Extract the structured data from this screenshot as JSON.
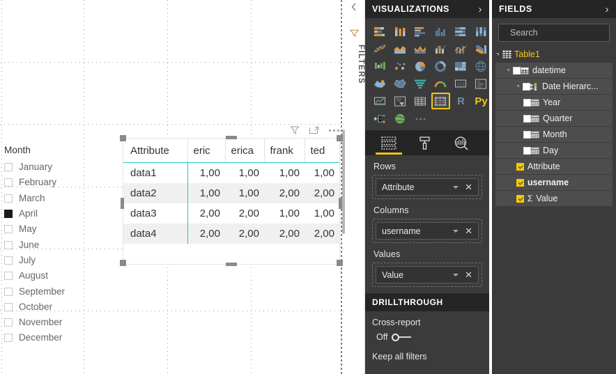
{
  "canvas": {
    "slicer": {
      "title": "Month",
      "items": [
        {
          "label": "January",
          "checked": false
        },
        {
          "label": "February",
          "checked": false
        },
        {
          "label": "March",
          "checked": false
        },
        {
          "label": "April",
          "checked": true
        },
        {
          "label": "May",
          "checked": false
        },
        {
          "label": "June",
          "checked": false
        },
        {
          "label": "July",
          "checked": false
        },
        {
          "label": "August",
          "checked": false
        },
        {
          "label": "September",
          "checked": false
        },
        {
          "label": "October",
          "checked": false
        },
        {
          "label": "November",
          "checked": false
        },
        {
          "label": "December",
          "checked": false
        }
      ]
    },
    "visual_header": {
      "filter_icon": "filter-funnel-icon",
      "focus_icon": "focus-mode-icon",
      "more_icon": "more-options-icon"
    },
    "matrix": {
      "columns": [
        "Attribute",
        "eric",
        "erica",
        "frank",
        "ted"
      ],
      "rows": [
        {
          "attribute": "data1",
          "values": [
            "1,00",
            "1,00",
            "1,00",
            "1,00"
          ]
        },
        {
          "attribute": "data2",
          "values": [
            "1,00",
            "1,00",
            "2,00",
            "2,00"
          ]
        },
        {
          "attribute": "data3",
          "values": [
            "2,00",
            "2,00",
            "1,00",
            "1,00"
          ]
        },
        {
          "attribute": "data4",
          "values": [
            "2,00",
            "2,00",
            "2,00",
            "2,00"
          ]
        }
      ],
      "accent_color": "#20c5c9",
      "alt_row_color": "#f0f0f0"
    }
  },
  "filters_rail": {
    "label": "FILTERS",
    "collapse_icon": "chevron-left-icon",
    "funnel_icon": "filter-funnel-icon"
  },
  "visualizations": {
    "title": "VISUALIZATIONS",
    "collapse_chevron": "›",
    "selected_visual": "matrix",
    "icons": [
      "stacked-bar-chart-icon",
      "stacked-column-chart-icon",
      "clustered-bar-chart-icon",
      "clustered-column-chart-icon",
      "100-stacked-bar-chart-icon",
      "100-stacked-column-chart-icon",
      "line-chart-icon",
      "area-chart-icon",
      "stacked-area-chart-icon",
      "line-stacked-column-chart-icon",
      "line-clustered-column-chart-icon",
      "ribbon-chart-icon",
      "waterfall-chart-icon",
      "scatter-chart-icon",
      "pie-chart-icon",
      "donut-chart-icon",
      "treemap-icon",
      "map-icon",
      "filled-map-icon",
      "shape-map-icon",
      "funnel-chart-icon",
      "gauge-chart-icon",
      "card-icon",
      "multi-row-card-icon",
      "kpi-icon",
      "slicer-icon",
      "table-icon",
      "matrix-icon",
      "r-script-visual-icon",
      "python-visual-icon",
      "decomposition-tree-icon",
      "arcgis-map-icon",
      "more-visuals-icon"
    ],
    "tabs": [
      {
        "name": "fields-tab",
        "icon": "fields-pane-icon",
        "active": true
      },
      {
        "name": "format-tab",
        "icon": "paint-roller-icon",
        "active": false
      },
      {
        "name": "analytics-tab",
        "icon": "magnifier-chart-icon",
        "active": false
      }
    ],
    "wells": [
      {
        "label": "Rows",
        "chip": "Attribute"
      },
      {
        "label": "Columns",
        "chip": "username"
      },
      {
        "label": "Values",
        "chip": "Value"
      }
    ],
    "drillthrough": {
      "title": "DRILLTHROUGH",
      "cross_report_label": "Cross-report",
      "cross_report_state": "Off",
      "keep_all_filters_label": "Keep all filters"
    },
    "accent_color": "#f2c811"
  },
  "fields": {
    "title": "FIELDS",
    "collapse_chevron": "›",
    "search": {
      "placeholder": "Search",
      "value": "",
      "icon": "search-icon"
    },
    "table": {
      "name": "Table1",
      "icon": "table-grid-icon"
    },
    "items": [
      {
        "label": "datetime",
        "indent": 1,
        "checked": false,
        "expander": true,
        "icon": "calendar-icon",
        "bold": false,
        "sigma": false
      },
      {
        "label": "Date Hierarc...",
        "indent": 2,
        "checked": false,
        "expander": true,
        "icon": "hierarchy-icon",
        "bold": false,
        "sigma": false
      },
      {
        "label": "Year",
        "indent": 3,
        "checked": false,
        "expander": false,
        "icon": "date-part-icon",
        "bold": false,
        "sigma": false
      },
      {
        "label": "Quarter",
        "indent": 3,
        "checked": false,
        "expander": false,
        "icon": "date-part-icon",
        "bold": false,
        "sigma": false
      },
      {
        "label": "Month",
        "indent": 3,
        "checked": false,
        "expander": false,
        "icon": "date-part-icon",
        "bold": false,
        "sigma": false
      },
      {
        "label": "Day",
        "indent": 3,
        "checked": false,
        "expander": false,
        "icon": "date-part-icon",
        "bold": false,
        "sigma": false
      },
      {
        "label": "Attribute",
        "indent": 2,
        "checked": true,
        "expander": false,
        "icon": "",
        "bold": false,
        "sigma": false
      },
      {
        "label": "username",
        "indent": 2,
        "checked": true,
        "expander": false,
        "icon": "",
        "bold": true,
        "sigma": false
      },
      {
        "label": "Value",
        "indent": 2,
        "checked": true,
        "expander": false,
        "icon": "",
        "bold": false,
        "sigma": true
      }
    ]
  }
}
